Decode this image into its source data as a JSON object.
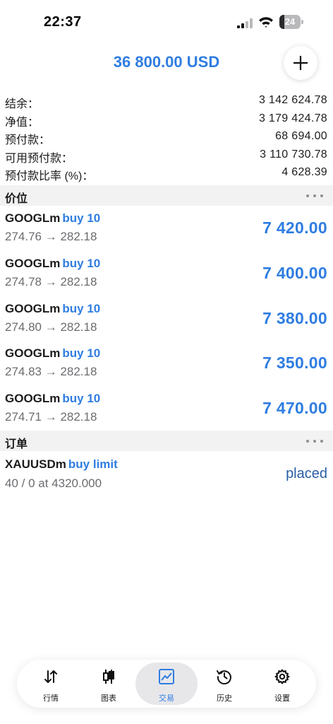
{
  "status_bar": {
    "time": "22:37",
    "battery_level": "24",
    "battery_fraction": 0.24
  },
  "header": {
    "total": "36 800.00 USD",
    "add_icon": "plus-icon"
  },
  "summary": [
    {
      "label": "结余：",
      "value": "3 142 624.78"
    },
    {
      "label": "净值：",
      "value": "3 179 424.78"
    },
    {
      "label": "预付款：",
      "value": "68 694.00"
    },
    {
      "label": "可用预付款：",
      "value": "3 110 730.78"
    },
    {
      "label": "预付款比率 (%)：",
      "value": "4 628.39"
    }
  ],
  "positions_section": {
    "title": "价位"
  },
  "positions": [
    {
      "symbol": "GOOGLm",
      "type": "buy 10",
      "prices": "274.76 → 282.18",
      "profit": "7 420.00"
    },
    {
      "symbol": "GOOGLm",
      "type": "buy 10",
      "prices": "274.78 → 282.18",
      "profit": "7 400.00"
    },
    {
      "symbol": "GOOGLm",
      "type": "buy 10",
      "prices": "274.80 → 282.18",
      "profit": "7 380.00"
    },
    {
      "symbol": "GOOGLm",
      "type": "buy 10",
      "prices": "274.83 → 282.18",
      "profit": "7 350.00"
    },
    {
      "symbol": "GOOGLm",
      "type": "buy 10",
      "prices": "274.71 → 282.18",
      "profit": "7 470.00"
    }
  ],
  "orders_section": {
    "title": "订单"
  },
  "orders": [
    {
      "symbol": "XAUUSDm",
      "type": "buy limit",
      "detail": "40 / 0 at 4320.000",
      "status": "placed"
    }
  ],
  "tabs": [
    {
      "label": "行情",
      "icon": "sort-arrows-icon",
      "active": false
    },
    {
      "label": "图表",
      "icon": "candlestick-icon",
      "active": false
    },
    {
      "label": "交易",
      "icon": "trade-chart-icon",
      "active": true
    },
    {
      "label": "历史",
      "icon": "history-icon",
      "active": false
    },
    {
      "label": "设置",
      "icon": "gear-icon",
      "active": false
    }
  ],
  "colors": {
    "accent": "#2f7de1",
    "status_placed": "#2a5ea6",
    "section_bg": "#f2f2f2"
  }
}
